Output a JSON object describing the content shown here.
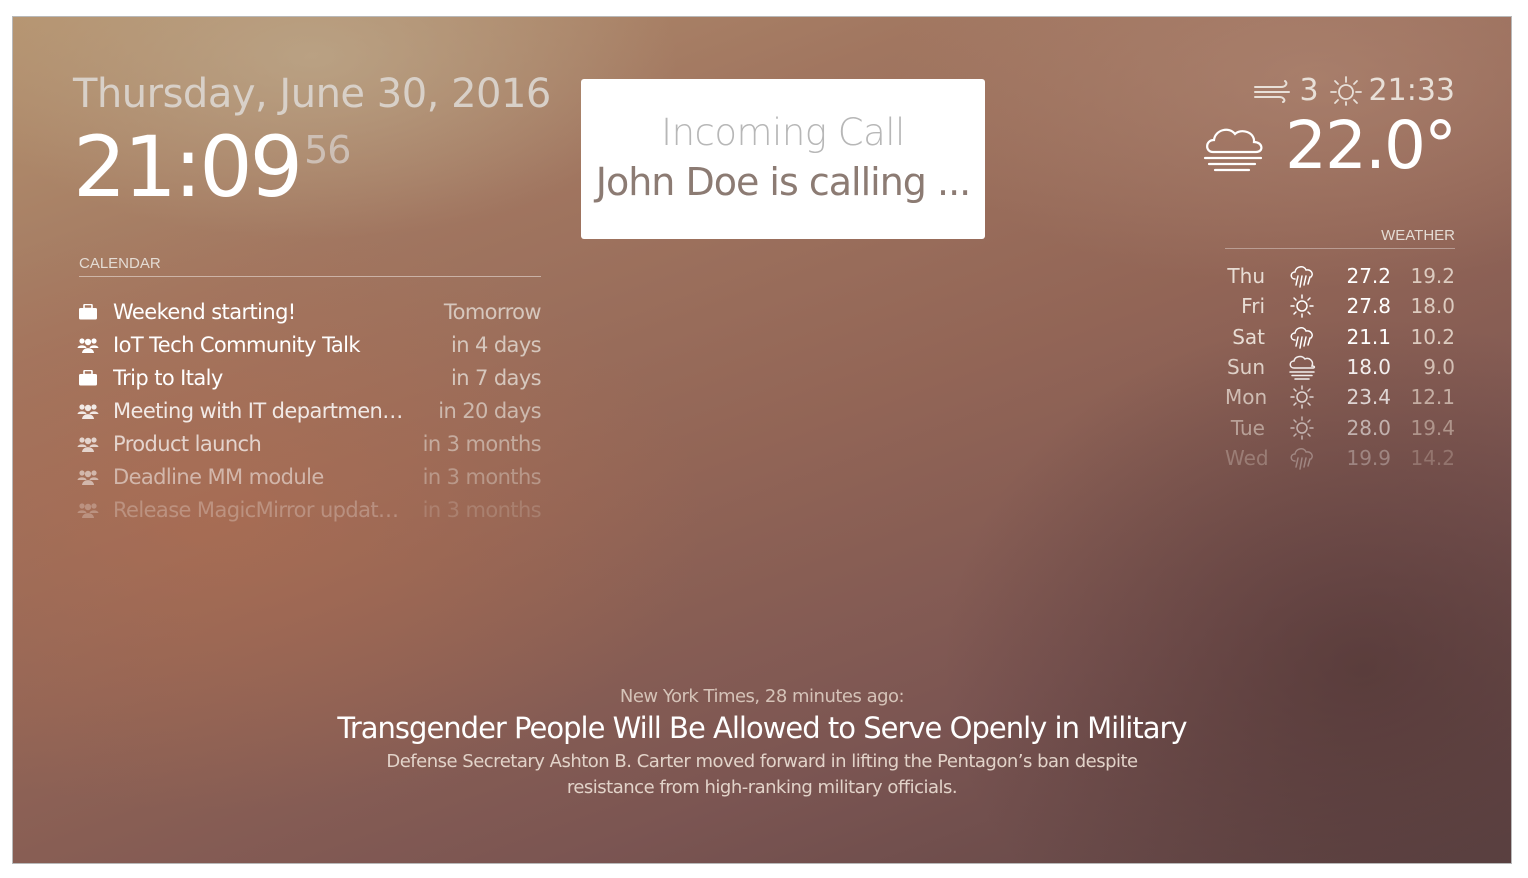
{
  "clock": {
    "date": "Thursday, June 30, 2016",
    "time": "21:09",
    "seconds": "56"
  },
  "calendar": {
    "header": "CALENDAR",
    "events": [
      {
        "icon": "briefcase-icon",
        "title": "Weekend starting!",
        "when": "Tomorrow",
        "opacity": 1.0
      },
      {
        "icon": "group-icon",
        "title": "IoT Tech Community Talk",
        "when": "in 4 days",
        "opacity": 1.0
      },
      {
        "icon": "briefcase-icon",
        "title": "Trip to Italy",
        "when": "in 7 days",
        "opacity": 1.0
      },
      {
        "icon": "group-icon",
        "title": "Meeting with IT departmen…",
        "when": "in 20 days",
        "opacity": 0.85
      },
      {
        "icon": "group-icon",
        "title": "Product launch",
        "when": "in 3 months",
        "opacity": 0.7
      },
      {
        "icon": "group-icon",
        "title": "Deadline MM module",
        "when": "in 3 months",
        "opacity": 0.5
      },
      {
        "icon": "group-icon",
        "title": "Release MagicMirror updat…",
        "when": "in 3 months",
        "opacity": 0.25
      }
    ]
  },
  "alert": {
    "title": "Incoming Call",
    "message": "John Doe is calling ..."
  },
  "current_weather": {
    "wind_icon": "wind-icon",
    "wind": "3",
    "sun_icon": "sunset-icon",
    "sun_time": "21:33",
    "condition_icon": "fog-cloud-icon",
    "temperature": "22.0°"
  },
  "forecast": {
    "header": "WEATHER",
    "days": [
      {
        "day": "Thu",
        "icon": "rain-icon",
        "max": "27.2",
        "min": "19.2",
        "opacity": 1.0
      },
      {
        "day": "Fri",
        "icon": "sun-icon",
        "max": "27.8",
        "min": "18.0",
        "opacity": 1.0
      },
      {
        "day": "Sat",
        "icon": "rain-icon",
        "max": "21.1",
        "min": "10.2",
        "opacity": 1.0
      },
      {
        "day": "Sun",
        "icon": "fog-cloud-icon",
        "max": "18.0",
        "min": "9.0",
        "opacity": 0.9
      },
      {
        "day": "Mon",
        "icon": "sun-icon",
        "max": "23.4",
        "min": "12.1",
        "opacity": 0.75
      },
      {
        "day": "Tue",
        "icon": "sun-icon",
        "max": "28.0",
        "min": "19.4",
        "opacity": 0.55
      },
      {
        "day": "Wed",
        "icon": "rain-icon",
        "max": "19.9",
        "min": "14.2",
        "opacity": 0.3
      }
    ]
  },
  "news": {
    "source": "New York Times, 28 minutes ago:",
    "title": "Transgender People Will Be Allowed to Serve Openly in Military",
    "description": "Defense Secretary Ashton B. Carter moved forward in lifting the Pentagon’s ban despite resistance from high-ranking military officials."
  }
}
